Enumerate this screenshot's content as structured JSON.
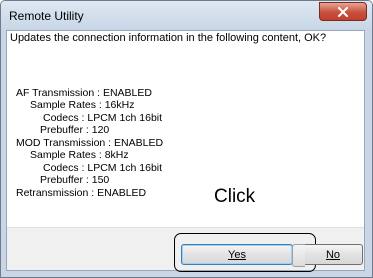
{
  "window": {
    "title": "Remote Utility",
    "close_icon": "close-icon"
  },
  "dialog": {
    "prompt": "Updates the connection information in the following content, OK?",
    "lines": [
      "AF Transmission : ENABLED",
      "Sample Rates : 16kHz",
      "Codecs : LPCM 1ch 16bit",
      "Prebuffer : 120",
      "MOD Transmission : ENABLED",
      "Sample Rates : 8kHz",
      "Codecs : LPCM 1ch 16bit",
      "Prebuffer : 150",
      "Retransmission : ENABLED"
    ]
  },
  "buttons": {
    "yes_label": "Yes",
    "no_label": "No"
  },
  "annotation": {
    "click_text": "Click"
  }
}
